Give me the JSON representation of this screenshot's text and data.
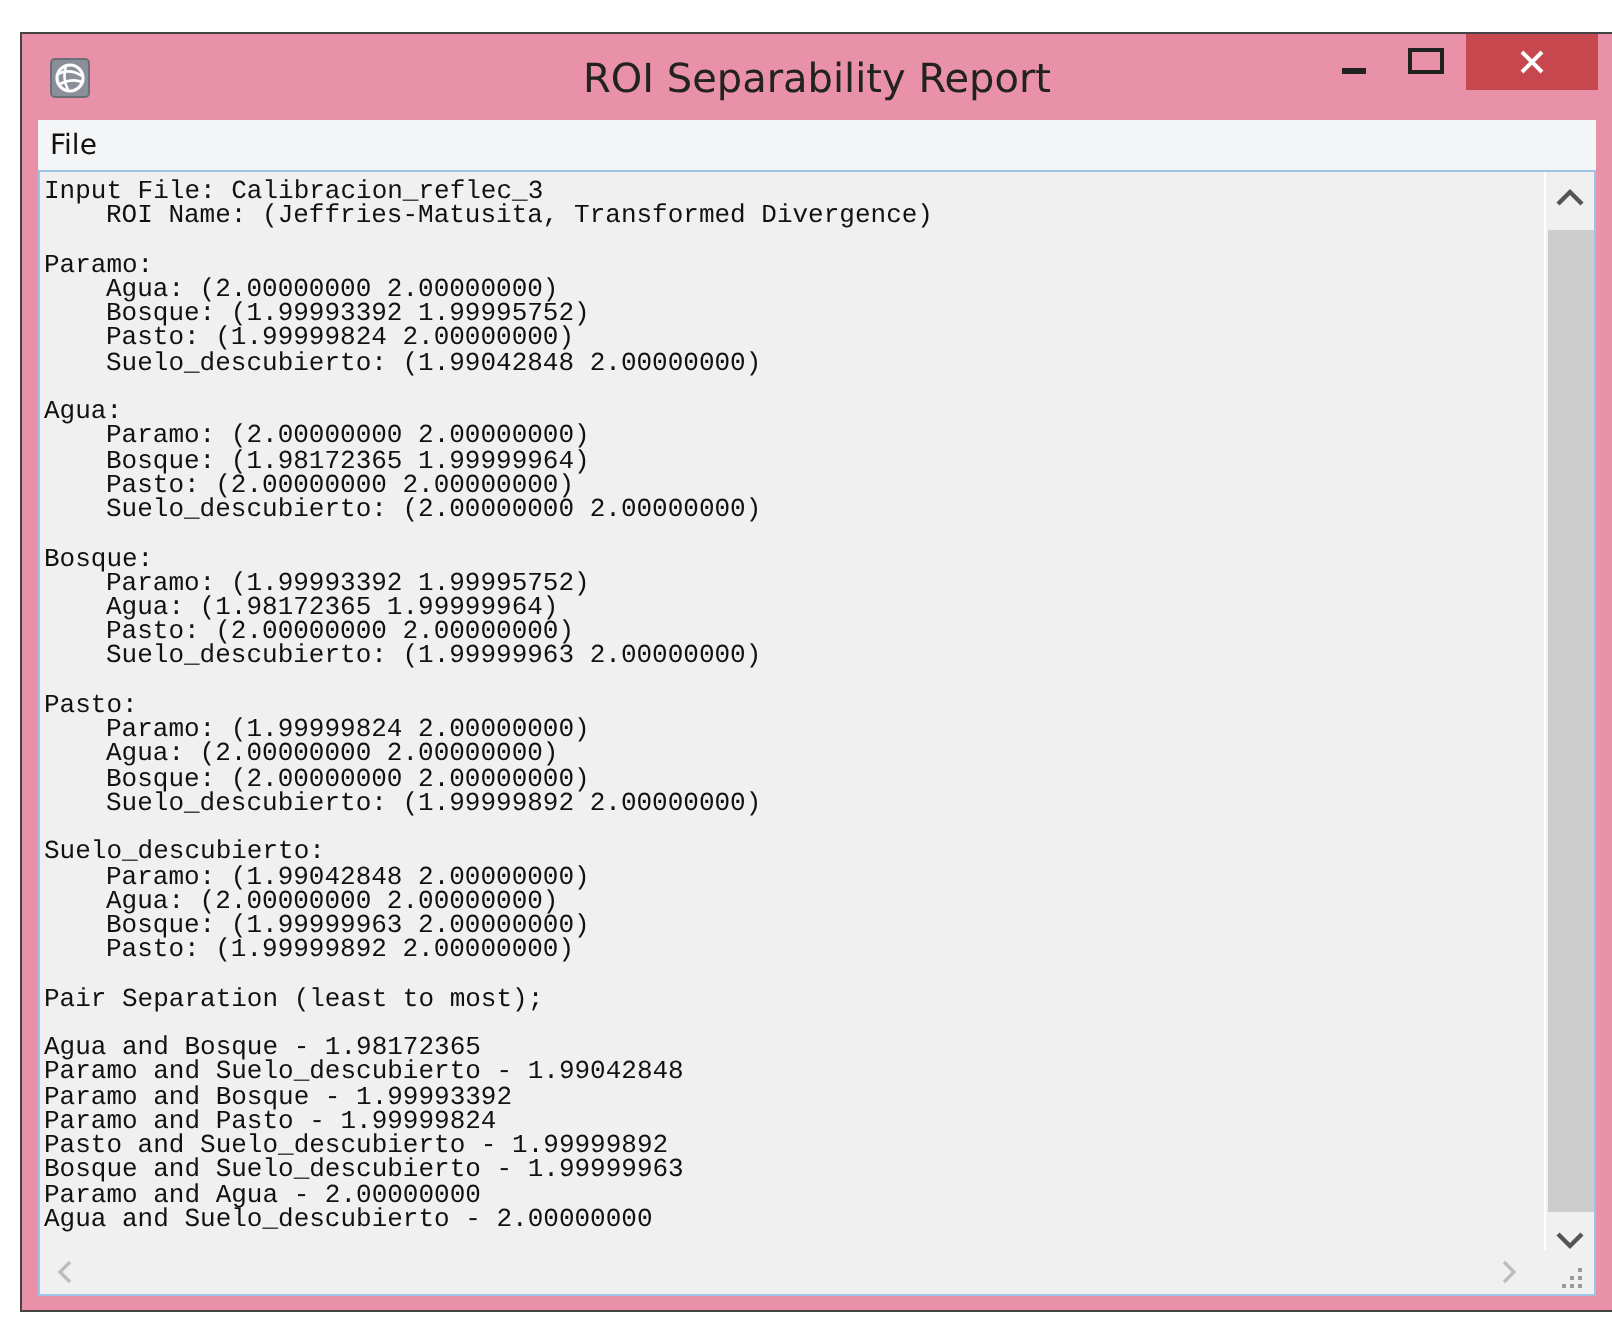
{
  "window": {
    "title": "ROI Separability Report"
  },
  "menu": [
    "File"
  ],
  "report": {
    "header": [
      "Input File: Calibracion_reflec_3",
      "ROI Name: (Jeffries-Matusita, Transformed Divergence)"
    ],
    "sections": [
      {
        "name": "Paramo:",
        "entries": [
          "Agua: (2.00000000 2.00000000)",
          "Bosque: (1.99993392 1.99995752)",
          "Pasto: (1.99999824 2.00000000)",
          "Suelo_descubierto: (1.99042848 2.00000000)"
        ]
      },
      {
        "name": "Agua:",
        "entries": [
          "Paramo: (2.00000000 2.00000000)",
          "Bosque: (1.98172365 1.99999964)",
          "Pasto: (2.00000000 2.00000000)",
          "Suelo_descubierto: (2.00000000 2.00000000)"
        ]
      },
      {
        "name": "Bosque:",
        "entries": [
          "Paramo: (1.99993392 1.99995752)",
          "Agua: (1.98172365 1.99999964)",
          "Pasto: (2.00000000 2.00000000)",
          "Suelo_descubierto: (1.99999963 2.00000000)"
        ]
      },
      {
        "name": "Pasto:",
        "entries": [
          "Paramo: (1.99999824 2.00000000)",
          "Agua: (2.00000000 2.00000000)",
          "Bosque: (2.00000000 2.00000000)",
          "Suelo_descubierto: (1.99999892 2.00000000)"
        ]
      },
      {
        "name": "Suelo_descubierto:",
        "entries": [
          "Paramo: (1.99042848 2.00000000)",
          "Agua: (2.00000000 2.00000000)",
          "Bosque: (1.99999963 2.00000000)",
          "Pasto: (1.99999892 2.00000000)"
        ]
      }
    ],
    "pair_heading": "Pair Separation (least to most);",
    "pairs": [
      "Agua and Bosque - 1.98172365",
      "Paramo and Suelo_descubierto - 1.99042848",
      "Paramo and Bosque - 1.99993392",
      "Paramo and Pasto - 1.99999824",
      "Pasto and Suelo_descubierto - 1.99999892",
      "Bosque and Suelo_descubierto - 1.99999963",
      "Paramo and Agua - 2.00000000",
      "Agua and Suelo_descubierto - 2.00000000"
    ]
  }
}
